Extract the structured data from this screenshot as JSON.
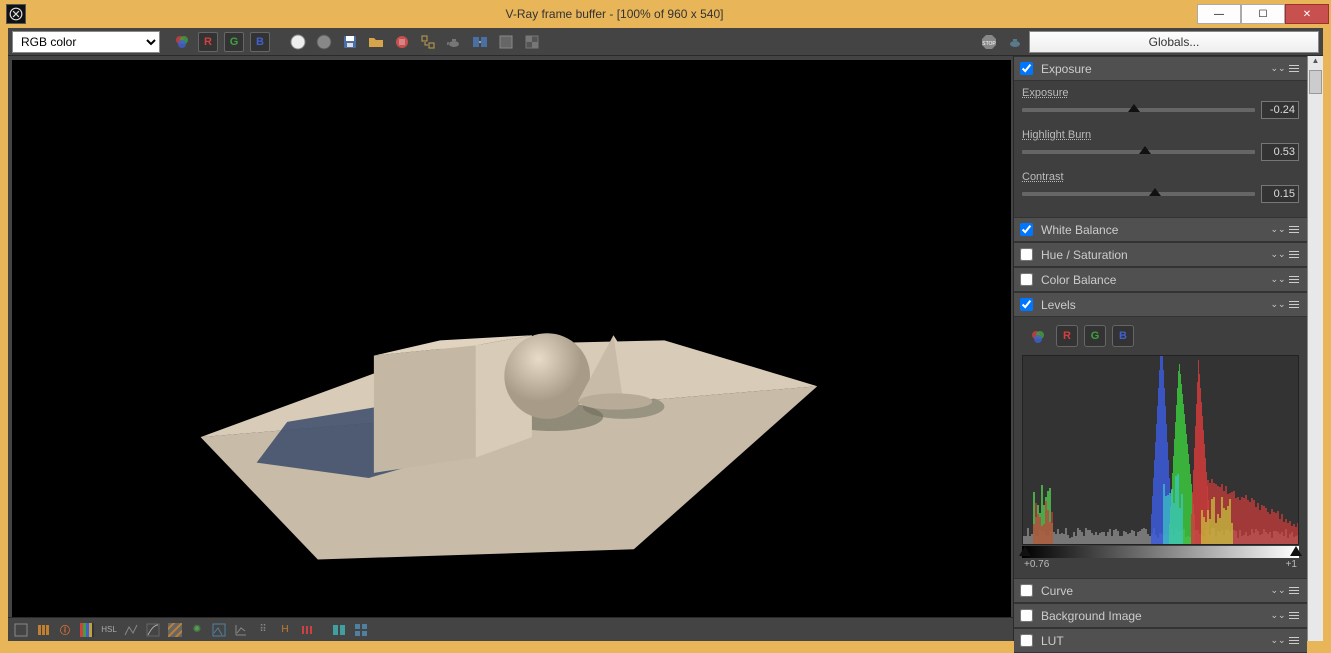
{
  "titlebar": {
    "title": "V-Ray frame buffer - [100% of 960 x 540]"
  },
  "toolbar": {
    "channel_selected": "RGB color",
    "globals_label": "Globals..."
  },
  "side": {
    "exposure": {
      "title": "Exposure",
      "enabled": true,
      "sliders": [
        {
          "label": "Exposure",
          "value": "-0.24",
          "pos": 48
        },
        {
          "label": "Highlight Burn",
          "value": "0.53",
          "pos": 53
        },
        {
          "label": "Contrast",
          "value": "0.15",
          "pos": 57
        }
      ]
    },
    "sections": [
      {
        "title": "White Balance",
        "enabled": true
      },
      {
        "title": "Hue / Saturation",
        "enabled": false
      },
      {
        "title": "Color Balance",
        "enabled": false
      }
    ],
    "levels": {
      "title": "Levels",
      "enabled": true,
      "grad_left": "+0.76",
      "grad_right": "+1"
    },
    "sections2": [
      {
        "title": "Curve",
        "enabled": false
      },
      {
        "title": "Background Image",
        "enabled": false
      },
      {
        "title": "LUT",
        "enabled": false
      }
    ]
  }
}
